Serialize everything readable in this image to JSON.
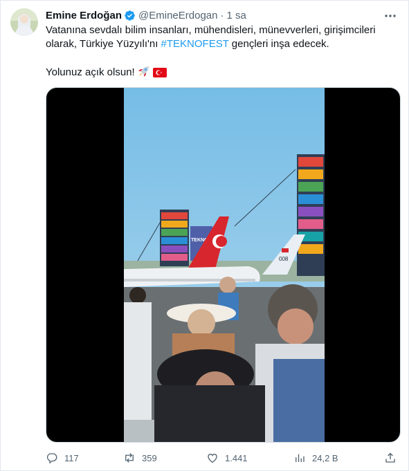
{
  "author": {
    "display_name": "Emine Erdoğan",
    "handle": "@EmineErdogan",
    "separator": "·",
    "time": "1 sa",
    "verified": true,
    "avatar_icon": "profile-photo"
  },
  "tweet": {
    "text_line1": "Vatanına sevdalı bilim insanları, mühendisleri, münevverleri, girişimcileri",
    "text_line2_before": "olarak, Türkiye Yüzyılı'nı ",
    "hashtag": "#TEKNOFEST",
    "text_line2_after": " gençleri inşa edecek.",
    "text_line3": "Yolunuz açık olsun!",
    "emojis": [
      "rocket-icon",
      "turkey-flag-icon"
    ]
  },
  "media": {
    "type": "video",
    "frame_signs": [
      "TEKNOFEST",
      "008"
    ]
  },
  "stats": {
    "replies": "117",
    "retweets": "359",
    "likes": "1.441",
    "views": "24,2 B"
  },
  "colors": {
    "accent": "#1d9bf0",
    "text": "#0f1419",
    "secondary": "#536471",
    "turkey_red": "#e30a17"
  }
}
